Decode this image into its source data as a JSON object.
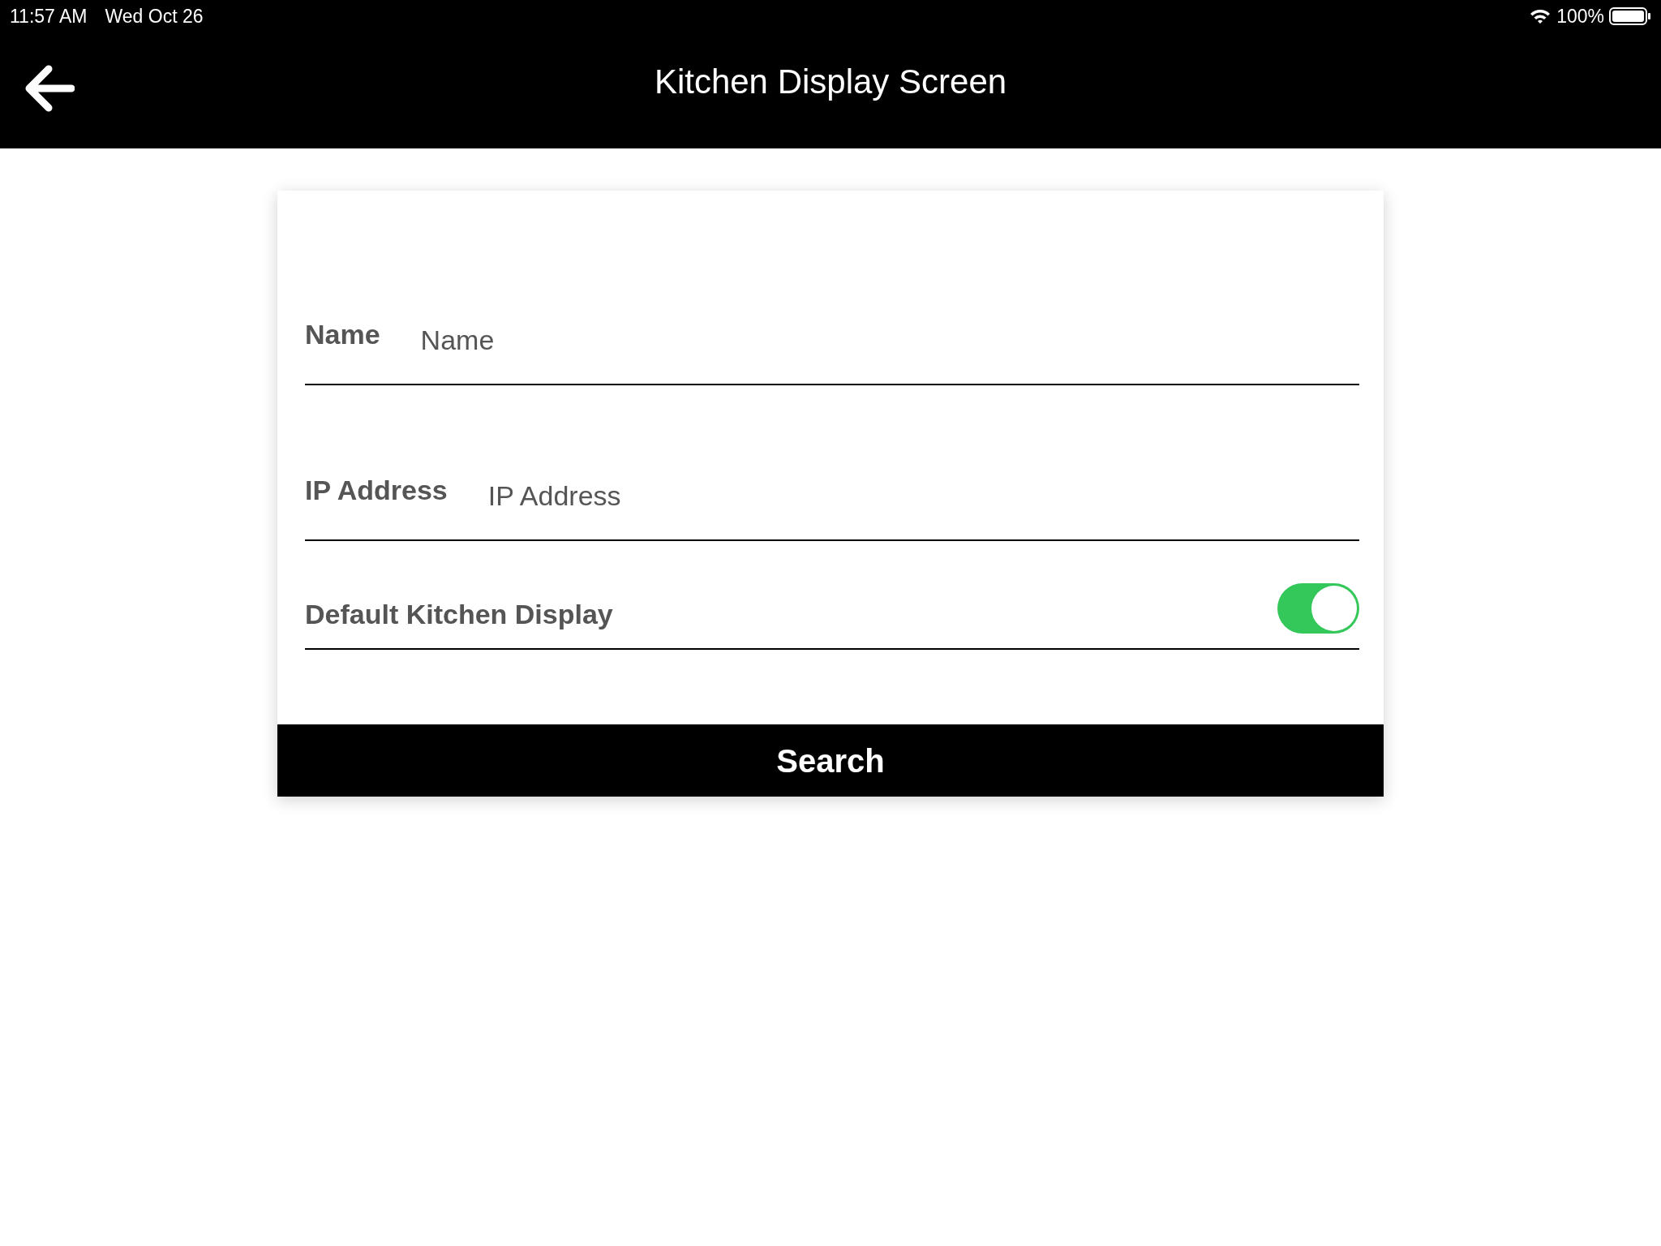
{
  "status_bar": {
    "time": "11:57 AM",
    "date": "Wed Oct 26",
    "battery": "100%"
  },
  "header": {
    "title": "Kitchen Display Screen"
  },
  "fields": [
    {
      "label": "Name",
      "placeholder": "Name"
    },
    {
      "label": "IP Address",
      "placeholder": "IP Address"
    }
  ],
  "toggle": {
    "label": "Default Kitchen Display",
    "on": true
  },
  "button": "Search"
}
